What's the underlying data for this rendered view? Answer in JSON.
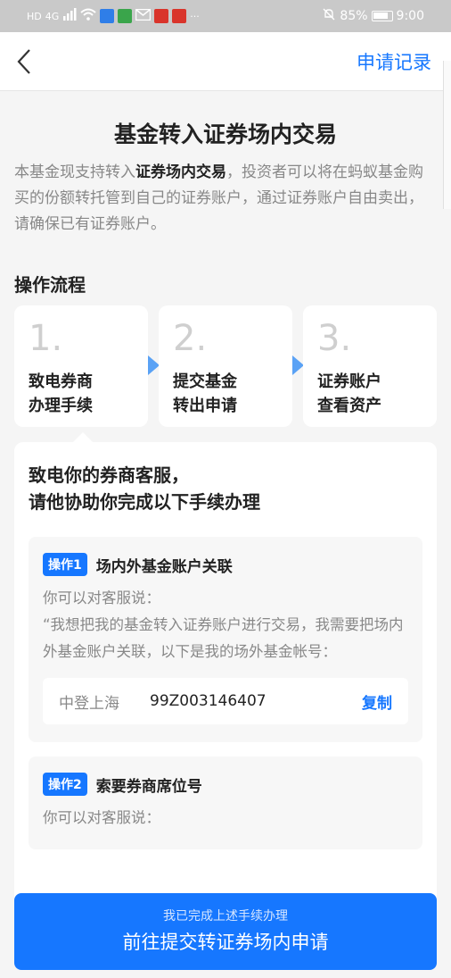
{
  "status_bar": {
    "left_text": "HD",
    "signal_text": "4G",
    "battery_percent": "85%",
    "time": "9:00",
    "dots": "···"
  },
  "nav": {
    "back_icon": "chevron-left-icon",
    "action_label": "申请记录"
  },
  "page": {
    "title": "基金转入证券场内交易",
    "intro_prefix": "本基金现支持转入",
    "intro_bold": "证券场内交易",
    "intro_suffix": "，投资者可以将在蚂蚁基金购买的份额转托管到自己的证券账户，通过证券账户自由卖出，请确保已有证券账户。"
  },
  "process": {
    "title": "操作流程",
    "steps": [
      {
        "num": "1.",
        "line1": "致电券商",
        "line2": "办理手续"
      },
      {
        "num": "2.",
        "line1": "提交基金",
        "line2": "转出申请"
      },
      {
        "num": "3.",
        "line1": "证券账户",
        "line2": "查看资产"
      }
    ]
  },
  "detail": {
    "head_line1": "致电你的券商客服，",
    "head_line2": "请他协助你完成以下手续办理",
    "ops": [
      {
        "tag": "操作1",
        "title": "场内外基金账户关联",
        "say": "你可以对客服说：",
        "quote": "“我想把我的基金转入证券账户进行交易，我需要把场内外基金账户关联，以下是我的场外基金帐号：",
        "account_label": "中登上海",
        "account_value": "99Z003146407",
        "copy_label": "复制"
      },
      {
        "tag": "操作2",
        "title": "索要券商席位号",
        "say": "你可以对客服说："
      }
    ]
  },
  "bottom_button": {
    "sub": "我已完成上述手续办理",
    "main": "前往提交转证券场内申请"
  },
  "colors": {
    "accent": "#1677ff",
    "status_bar_bg": "#c9c9c9",
    "page_bg": "#f5f5f5"
  }
}
